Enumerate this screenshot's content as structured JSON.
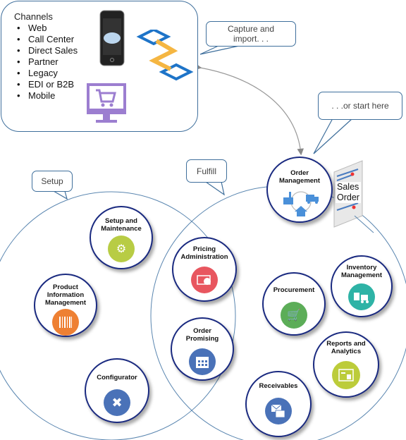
{
  "channels": {
    "title": "Channels",
    "items": [
      "Web",
      "Call Center",
      "Direct Sales",
      "Partner",
      "Legacy",
      "EDI or B2B",
      "Mobile"
    ]
  },
  "callouts": {
    "capture": "Capture  and import. . .",
    "start": ". . .or start here",
    "setup": "Setup",
    "fulfill": "Fulfill"
  },
  "sales_order": {
    "line1": "Sales",
    "line2": "Order"
  },
  "nodes": {
    "order_management": {
      "label": "Order Management",
      "color": "#4a90d9"
    },
    "setup_maintenance": {
      "label": "Setup and Maintenance",
      "color": "#b8cc44"
    },
    "product_info": {
      "label": "Product Information Management",
      "color": "#ee8033"
    },
    "configurator": {
      "label": "Configurator",
      "color": "#4a72b8"
    },
    "pricing_admin": {
      "label": "Pricing Administration",
      "color": "#e8565f"
    },
    "order_promising": {
      "label": "Order Promising",
      "color": "#4a72b8"
    },
    "procurement": {
      "label": "Procurement",
      "color": "#5cad58"
    },
    "inventory": {
      "label": "Inventory Management",
      "color": "#2eb3a6"
    },
    "reports": {
      "label": "Reports and Analytics",
      "color": "#bccc3a"
    },
    "receivables": {
      "label": "Receivables",
      "color": "#4a72b8"
    }
  }
}
